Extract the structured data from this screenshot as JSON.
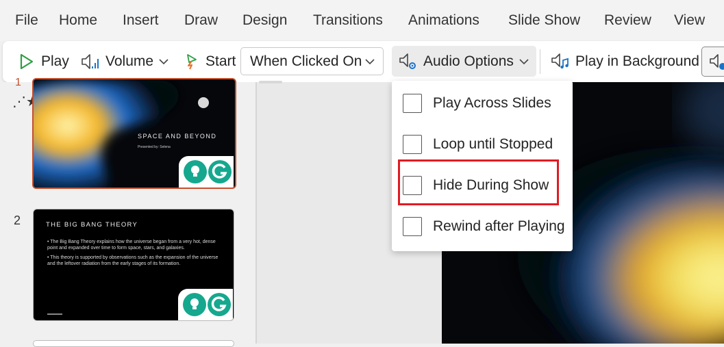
{
  "menu": [
    "File",
    "Home",
    "Insert",
    "Draw",
    "Design",
    "Transitions",
    "Animations",
    "Slide Show",
    "Review",
    "View"
  ],
  "ribbon": {
    "play_label": "Play",
    "volume_label": "Volume",
    "start_label": "Start",
    "start_value": "When Clicked On",
    "audio_options_label": "Audio Options",
    "play_background_label": "Play in Background"
  },
  "audio_menu": {
    "options": [
      "Play Across Slides",
      "Loop until Stopped",
      "Hide During Show",
      "Rewind after Playing"
    ]
  },
  "slides": [
    {
      "number": "1",
      "title": "SPACE AND BEYOND",
      "subtitle": "Presented by: Selena"
    },
    {
      "number": "2",
      "title": "THE BIG BANG THEORY",
      "bullets": [
        "The Big Bang Theory explains how the universe began from a very hot, dense point and expanded over time to form space, stars, and galaxies.",
        "This theory is supported by observations such as the expansion of the universe and the leftover radiation from the early stages of its formation."
      ]
    }
  ],
  "colors": {
    "accent": "#c3502d",
    "highlight": "#e11b22",
    "play_green": "#2e9e44",
    "start_orange": "#e8702a"
  }
}
